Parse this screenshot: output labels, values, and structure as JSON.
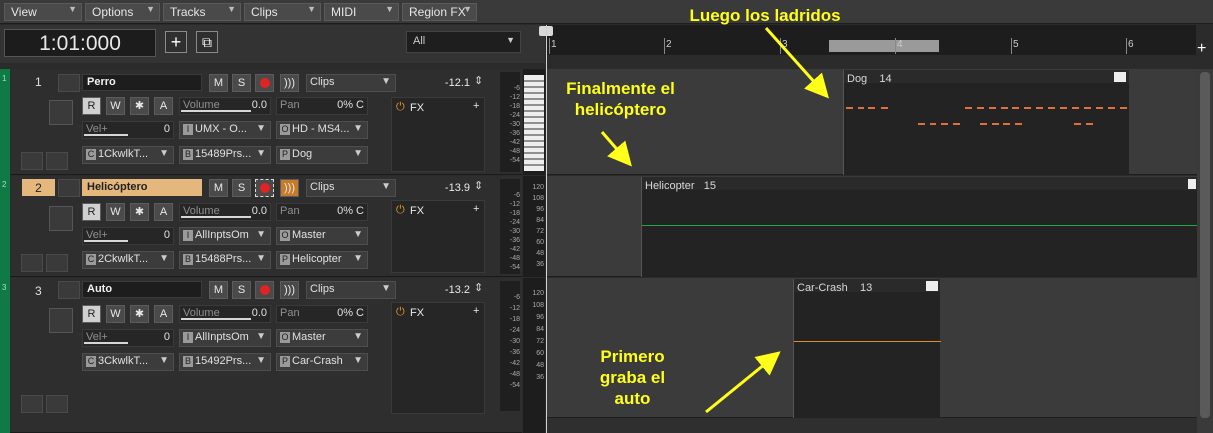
{
  "menu": {
    "items": [
      "View",
      "Options",
      "Tracks",
      "Clips",
      "MIDI",
      "Region FX"
    ]
  },
  "transport": {
    "time": "1:01:000",
    "filter": "All"
  },
  "ruler": {
    "marks": [
      "1",
      "2",
      "3",
      "4",
      "5",
      "6"
    ]
  },
  "tracks": [
    {
      "num": "1",
      "name": "Perro",
      "mode": "Clips",
      "volume_db": "-12.1",
      "volume_label": "Volume",
      "volume_val": "0.0",
      "pan_label": "Pan",
      "pan_val": "0% C",
      "vel_label": "Vel+",
      "vel_val": "0",
      "input": "UMX - O...",
      "output": "HD - MS4...",
      "channel": "1CkwlkT...",
      "bank": "15489Prs...",
      "patch": "Dog",
      "fx": "FX"
    },
    {
      "num": "2",
      "name": "Helicóptero",
      "mode": "Clips",
      "volume_db": "-13.9",
      "volume_label": "Volume",
      "volume_val": "0.0",
      "pan_label": "Pan",
      "pan_val": "0% C",
      "vel_label": "Vel+",
      "vel_val": "0",
      "input": "AllInptsOm",
      "output": "Master",
      "channel": "2CkwlkT...",
      "bank": "15488Prs...",
      "patch": "Helicopter",
      "fx": "FX"
    },
    {
      "num": "3",
      "name": "Auto",
      "mode": "Clips",
      "volume_db": "-13.2",
      "volume_label": "Volume",
      "volume_val": "0.0",
      "pan_label": "Pan",
      "pan_val": "0% C",
      "vel_label": "Vel+",
      "vel_val": "0",
      "input": "AllInptsOm",
      "output": "Master",
      "channel": "3CkwlkT...",
      "bank": "15492Prs...",
      "patch": "Car-Crash",
      "fx": "FX"
    }
  ],
  "buttons": {
    "mute": "M",
    "solo": "S",
    "read": "R",
    "write": "W",
    "star": "✱",
    "auto": "A"
  },
  "meter_ticks": [
    "-6",
    "-12",
    "-18",
    "-24",
    "-30",
    "-36",
    "-42",
    "-48",
    "-54"
  ],
  "key_ticks": [
    "120",
    "108",
    "96",
    "84",
    "72",
    "60",
    "48",
    "36"
  ],
  "clips": [
    {
      "name": "Dog",
      "count": "14"
    },
    {
      "name": "Helicopter",
      "count": "15"
    },
    {
      "name": "Car-Crash",
      "count": "13"
    }
  ],
  "annotations": {
    "a1": "Luego los ladridos",
    "a2_l1": "Finalmente el",
    "a2_l2": "helicóptero",
    "a3_l1": "Primero",
    "a3_l2": "graba el",
    "a3_l3": "auto"
  },
  "colors": {
    "record": "#e02424",
    "selected_track": "#e4b77c",
    "accent_green": "#0f7a45",
    "annotation": "#ffff1a",
    "dog_notes": "#e0703a",
    "heli_line": "#1fa84a",
    "car_line": "#e09020"
  }
}
